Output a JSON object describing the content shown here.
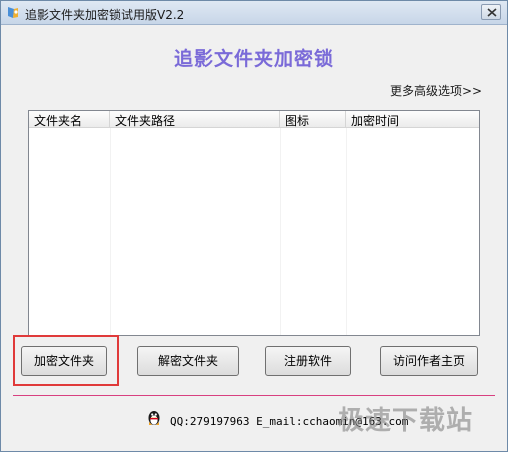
{
  "window": {
    "title": "追影文件夹加密锁试用版V2.2"
  },
  "header": {
    "heading": "追影文件夹加密锁",
    "more_options": "更多高级选项>>"
  },
  "table": {
    "columns": [
      "文件夹名",
      "文件夹路径",
      "图标",
      "加密时间"
    ],
    "rows": []
  },
  "buttons": {
    "encrypt": "加密文件夹",
    "decrypt": "解密文件夹",
    "register": "注册软件",
    "visit": "访问作者主页"
  },
  "footer": {
    "contact": "QQ:279197963 E_mail:cchaomin@163.com",
    "watermark": "极速下载站"
  },
  "colors": {
    "heading": "#7a6ad8",
    "highlight_border": "#e03a3a",
    "divider": "#d84080"
  }
}
